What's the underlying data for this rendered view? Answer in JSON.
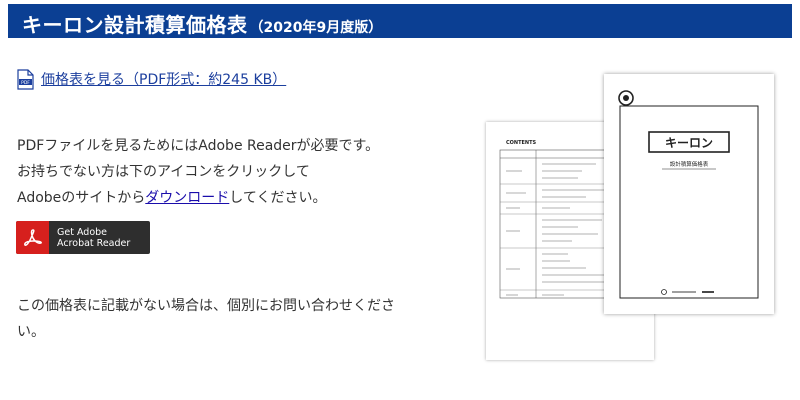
{
  "header": {
    "title": "キーロン設計積算価格表",
    "subtitle": "（2020年9月度版）"
  },
  "pdf_link": {
    "icon": "pdf-file-icon",
    "icon_label": "PDF",
    "label": "価格表を見る（PDF形式：約245 KB）"
  },
  "instructions": {
    "line1": "PDFファイルを見るためにはAdobe Readerが必要です。",
    "line2": "お持ちでない方は下のアイコンをクリックして",
    "line3_before": "Adobeのサイトから",
    "line3_link": "ダウンロード",
    "line3_after": "してください。"
  },
  "adobe_badge": {
    "line1": "Get Adobe",
    "line2": "Acrobat Reader"
  },
  "notice": {
    "line1": "この価格表に記載がない場合は、個別にお問い合わせくださ",
    "line2": "い。"
  },
  "catalog": {
    "contents_heading": "CONTENTS",
    "cover_brand": "キーロン",
    "cover_title": "設計積算価格表"
  },
  "colors": {
    "header_bg": "#0b3f93",
    "link": "#1c3f9e",
    "adobe_red": "#d6201d"
  }
}
